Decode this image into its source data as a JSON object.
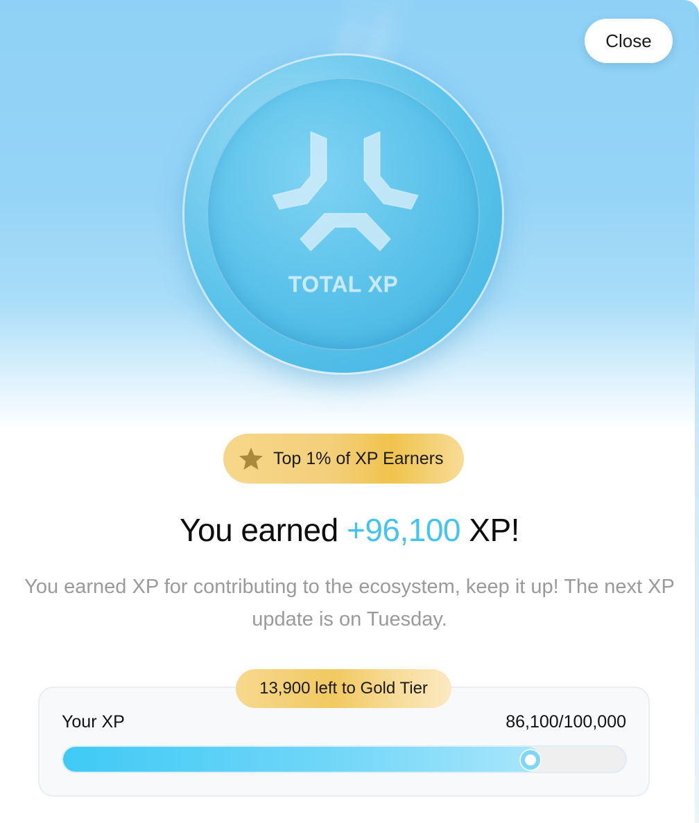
{
  "modal": {
    "close_label": "Close"
  },
  "coin": {
    "label": "TOTAL XP",
    "logo_icon": "xp-logo-icon"
  },
  "rank_badge": {
    "icon": "star-icon",
    "label": "Top 1% of XP Earners"
  },
  "headline": {
    "prefix": "You earned ",
    "amount": "+96,100",
    "suffix": " XP!"
  },
  "description": "You earned XP for contributing to the ecosystem, keep it up! The next XP update is on Tuesday.",
  "progress": {
    "tier_badge": "13,900 left to Gold Tier",
    "label": "Your XP",
    "count": "86,100/100,000",
    "current": 86100,
    "target": 100000
  },
  "colors": {
    "accent": "#43c4f0",
    "gold": "#f2c960",
    "hero_blue": "#8fd1f6"
  }
}
